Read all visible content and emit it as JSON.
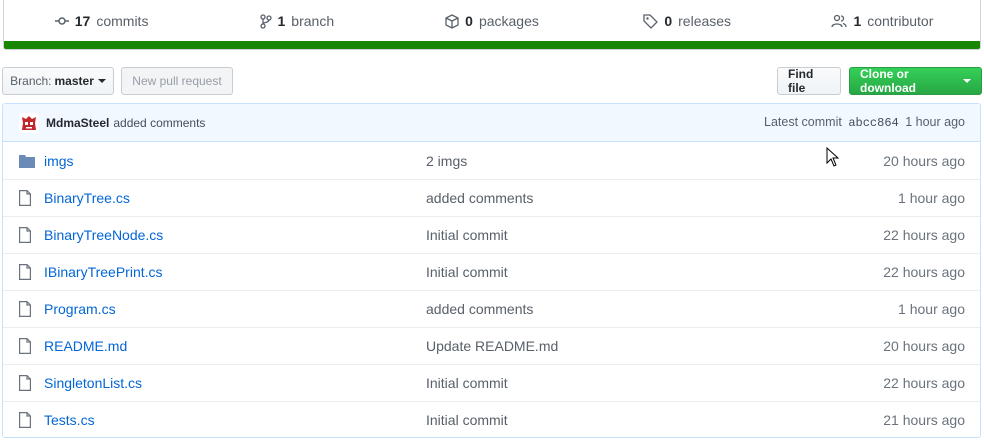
{
  "stats": {
    "commits": {
      "count": "17",
      "label": "commits",
      "icon": "commit-icon"
    },
    "branches": {
      "count": "1",
      "label": "branch",
      "icon": "branch-icon"
    },
    "packages": {
      "count": "0",
      "label": "packages",
      "icon": "package-icon"
    },
    "releases": {
      "count": "0",
      "label": "releases",
      "icon": "tag-icon"
    },
    "contributors": {
      "count": "1",
      "label": "contributor",
      "icon": "people-icon"
    }
  },
  "language_bar_color": "#178600",
  "nav": {
    "branch_label": "Branch:",
    "branch_value": "master",
    "new_pr": "New pull request",
    "find_file": "Find file",
    "clone": "Clone or download"
  },
  "commit": {
    "author": "MdmaSteel",
    "message": "added comments",
    "latest_label": "Latest commit",
    "sha": "abcc864",
    "age": "1 hour ago"
  },
  "files": [
    {
      "type": "folder",
      "name": "imgs",
      "message": "2 imgs",
      "age": "20 hours ago"
    },
    {
      "type": "file",
      "name": "BinaryTree.cs",
      "message": "added comments",
      "age": "1 hour ago"
    },
    {
      "type": "file",
      "name": "BinaryTreeNode.cs",
      "message": "Initial commit",
      "age": "22 hours ago"
    },
    {
      "type": "file",
      "name": "IBinaryTreePrint.cs",
      "message": "Initial commit",
      "age": "22 hours ago"
    },
    {
      "type": "file",
      "name": "Program.cs",
      "message": "added comments",
      "age": "1 hour ago"
    },
    {
      "type": "file",
      "name": "README.md",
      "message": "Update README.md",
      "age": "20 hours ago"
    },
    {
      "type": "file",
      "name": "SingletonList.cs",
      "message": "Initial commit",
      "age": "22 hours ago"
    },
    {
      "type": "file",
      "name": "Tests.cs",
      "message": "Initial commit",
      "age": "21 hours ago"
    }
  ]
}
